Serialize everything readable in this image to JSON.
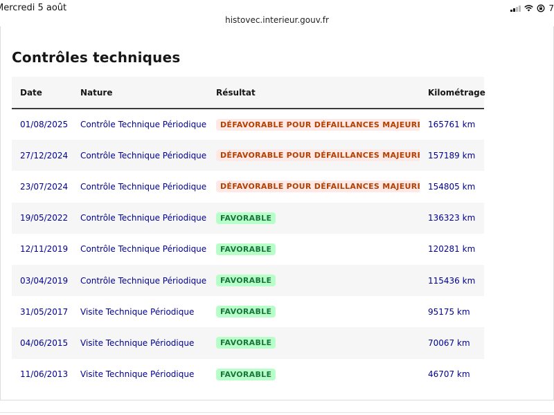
{
  "status_bar": {
    "date": "Mercredi 5 août",
    "battery_partial": "7"
  },
  "browser": {
    "url": "histovec.interieur.gouv.fr"
  },
  "section": {
    "title": "Contrôles techniques"
  },
  "table": {
    "headers": {
      "date": "Date",
      "nature": "Nature",
      "result": "Résultat",
      "km": "Kilométrage"
    },
    "rows": [
      {
        "date": "01/08/2025",
        "nature": "Contrôle Technique Périodique",
        "result": "DÉFAVORABLE POUR DÉFAILLANCES MAJEURES",
        "status": "bad",
        "km": "165761 km"
      },
      {
        "date": "27/12/2024",
        "nature": "Contrôle Technique Périodique",
        "result": "DÉFAVORABLE POUR DÉFAILLANCES MAJEURES",
        "status": "bad",
        "km": "157189 km"
      },
      {
        "date": "23/07/2024",
        "nature": "Contrôle Technique Périodique",
        "result": "DÉFAVORABLE POUR DÉFAILLANCES MAJEURES",
        "status": "bad",
        "km": "154805 km"
      },
      {
        "date": "19/05/2022",
        "nature": "Contrôle Technique Périodique",
        "result": "FAVORABLE",
        "status": "good",
        "km": "136323 km"
      },
      {
        "date": "12/11/2019",
        "nature": "Contrôle Technique Périodique",
        "result": "FAVORABLE",
        "status": "good",
        "km": "120281 km"
      },
      {
        "date": "03/04/2019",
        "nature": "Contrôle Technique Périodique",
        "result": "FAVORABLE",
        "status": "good",
        "km": "115436 km"
      },
      {
        "date": "31/05/2017",
        "nature": "Visite Technique Périodique",
        "result": "FAVORABLE",
        "status": "good",
        "km": "95175 km"
      },
      {
        "date": "04/06/2015",
        "nature": "Visite Technique Périodique",
        "result": "FAVORABLE",
        "status": "good",
        "km": "70067 km"
      },
      {
        "date": "11/06/2013",
        "nature": "Visite Technique Périodique",
        "result": "FAVORABLE",
        "status": "good",
        "km": "46707 km"
      }
    ]
  },
  "colors": {
    "link_blue": "#000091",
    "bad_bg": "#fee9e6",
    "bad_text": "#b34000",
    "good_bg": "#b8fec9",
    "good_text": "#18753c",
    "row_alt": "#f6f6f6"
  },
  "icons": {
    "signal": "signal-icon",
    "wifi": "wifi-icon",
    "orientation_lock": "orientation-lock-icon"
  }
}
